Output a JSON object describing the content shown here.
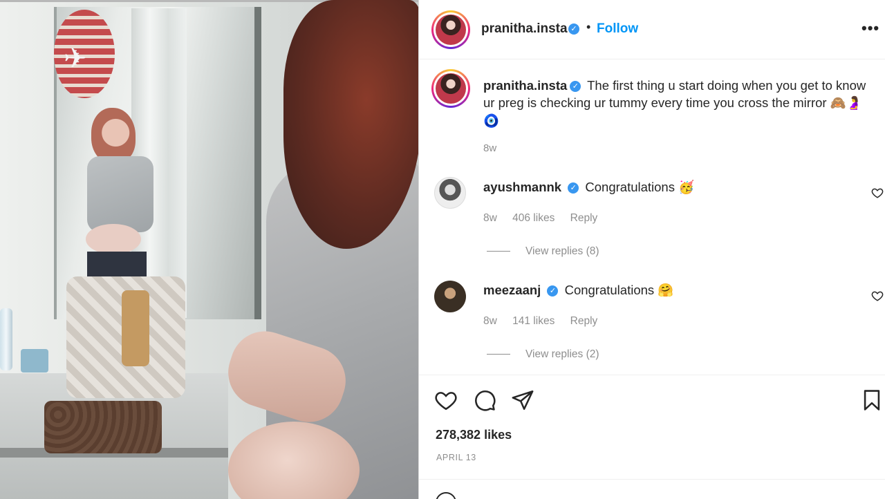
{
  "post": {
    "username": "pranitha.insta",
    "follow_label": "Follow",
    "more_label": "•••",
    "separator": "•",
    "caption": "The first thing u start doing when you get to know ur preg is checking ur tummy every time you cross the mirror",
    "caption_emojis": "🙈🤰🧿",
    "caption_age": "8w",
    "likes": "278,382 likes",
    "date": "APRIL 13"
  },
  "comments": [
    {
      "username": "ayushmannk",
      "text": "Congratulations",
      "emoji": "🥳",
      "age": "8w",
      "likes": "406 likes",
      "reply_label": "Reply",
      "view_replies": "View replies (8)"
    },
    {
      "username": "meezaanj",
      "text": "Congratulations",
      "emoji": "🤗",
      "age": "8w",
      "likes": "141 likes",
      "reply_label": "Reply",
      "view_replies": "View replies (2)"
    }
  ],
  "icons": {
    "verified": "verified-badge-icon",
    "like": "heart-icon",
    "comment": "comment-icon",
    "share": "share-icon",
    "save": "bookmark-icon"
  },
  "colors": {
    "link": "#0095f6",
    "verified": "#3897f0",
    "muted": "#8e8e8e",
    "text": "#262626"
  }
}
